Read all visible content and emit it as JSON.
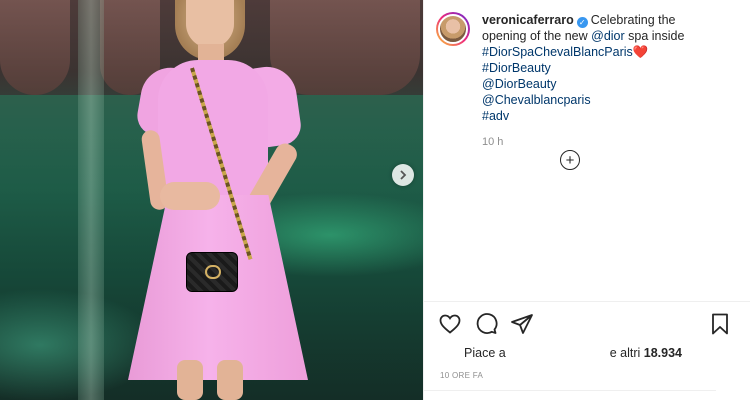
{
  "post": {
    "username": "veronicaferraro",
    "caption_before": "Celebrating the opening of the new ",
    "caption_mention": "@dior",
    "caption_after": " spa inside",
    "hashtag_line": "#DiorSpaChevalBlancParis",
    "heart_emoji": "❤️",
    "tags": [
      "#DiorBeauty",
      "@DiorBeauty",
      "@Chevalblancparis",
      "#adv"
    ],
    "relative_time": "10 h",
    "likes_prefix": "Piace a",
    "likes_suffix": "e altri",
    "likes_count": "18.934",
    "timestamp_label": "10 ORE FA"
  },
  "icons": {
    "next": "chevron-right-icon",
    "add_comment": "plus-circle-icon",
    "like": "heart-icon",
    "comment": "comment-icon",
    "share": "paper-plane-icon",
    "save": "bookmark-icon",
    "verified": "verified-badge-icon"
  },
  "colors": {
    "link": "#00376b",
    "verified": "#3897f0",
    "dress": "#f2a8e5",
    "muted": "#8e8e8e"
  }
}
